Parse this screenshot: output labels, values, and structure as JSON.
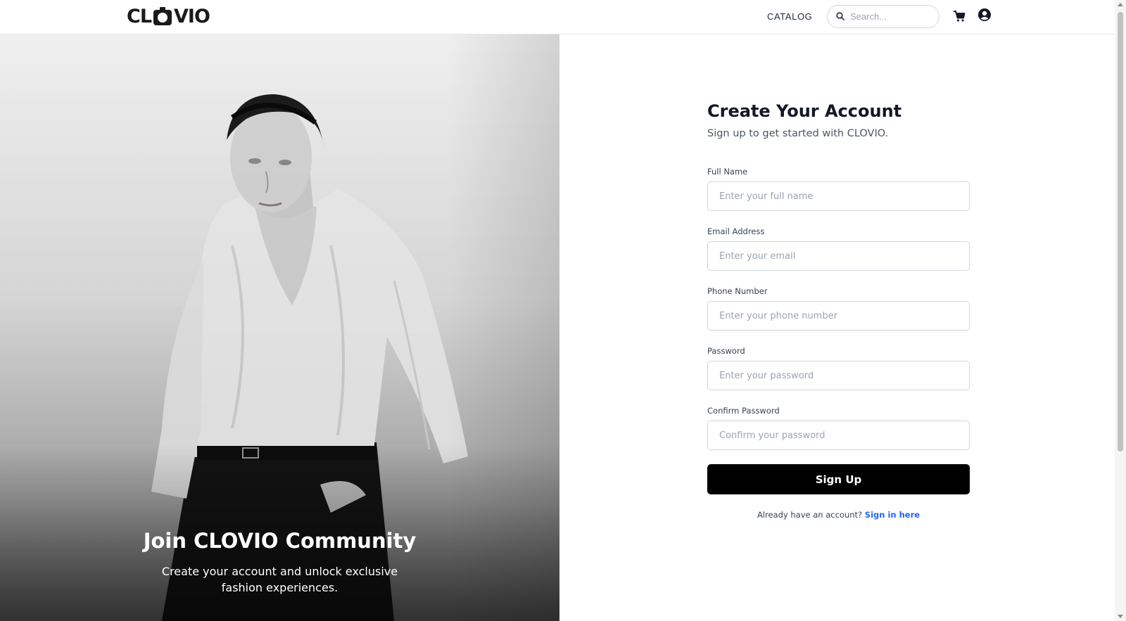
{
  "header": {
    "logo_text_left": "CL",
    "logo_text_right": "VIO",
    "logo_alt": "CLOVIO",
    "nav_catalog": "CATALOG",
    "search_placeholder": "Search...",
    "cart_icon": "cart-icon",
    "user_icon": "user-icon"
  },
  "hero": {
    "title": "Join CLOVIO Community",
    "subtitle": "Create your account and unlock exclusive fashion experiences."
  },
  "form": {
    "title": "Create Your Account",
    "subtitle": "Sign up to get started with CLOVIO.",
    "fields": [
      {
        "label": "Full Name",
        "placeholder": "Enter your full name",
        "value": ""
      },
      {
        "label": "Email Address",
        "placeholder": "Enter your email",
        "value": ""
      },
      {
        "label": "Phone Number",
        "placeholder": "Enter your phone number",
        "value": ""
      },
      {
        "label": "Password",
        "placeholder": "Enter your password",
        "value": ""
      },
      {
        "label": "Confirm Password",
        "placeholder": "Confirm your password",
        "value": ""
      }
    ],
    "submit_label": "Sign Up",
    "signin_prompt": "Already have an account?",
    "signin_link": "Sign in here"
  },
  "colors": {
    "accent_link": "#2563eb",
    "button_bg": "#000000",
    "text_primary": "#111827"
  }
}
